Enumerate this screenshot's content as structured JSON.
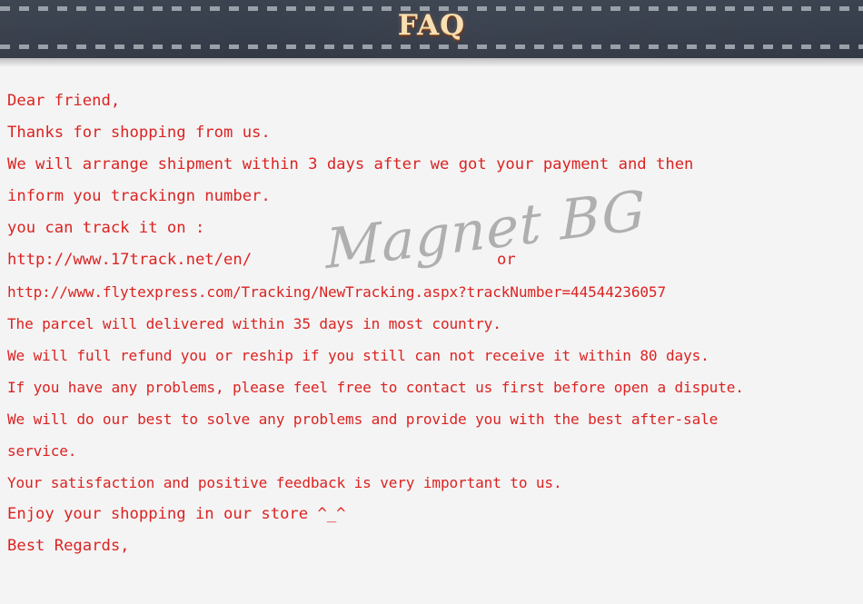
{
  "header": {
    "title": "FAQ",
    "background_color": "#383f4c",
    "title_color": "#f7e0b4",
    "stitch_color": "#9aa0a8"
  },
  "watermark": {
    "text": "Magnet BG",
    "color": "#a3a3a3"
  },
  "body": {
    "background_color": "#f4f4f4",
    "text_color": "#dc2322",
    "lines": [
      "Dear friend,",
      "Thanks for shopping from us.",
      "We will arrange shipment within 3 days after we got your payment and then",
      "inform you trackingn number.",
      "you can track it on :",
      "http://www.17track.net/en/",
      "or",
      "http://www.flytexpress.com/Tracking/NewTracking.aspx?trackNumber=44544236057",
      "The parcel will delivered within 35 days in most country.",
      "We will full refund you or reship if you still can not receive it within 80 days.",
      "If you have any problems, please feel free to contact us first before open a dispute.",
      "We will do our best to solve any problems and provide you with the best after-sale",
      "service.",
      "Your satisfaction and positive feedback is very important to us.",
      "Enjoy your shopping in our store ^_^",
      "Best Regards,"
    ],
    "tracking_number": "44544236057",
    "tracking_url_1": "http://www.17track.net/en/",
    "tracking_url_2": "http://www.flytexpress.com/Tracking/NewTracking.aspx?trackNumber=44544236057",
    "or_label": "or"
  }
}
